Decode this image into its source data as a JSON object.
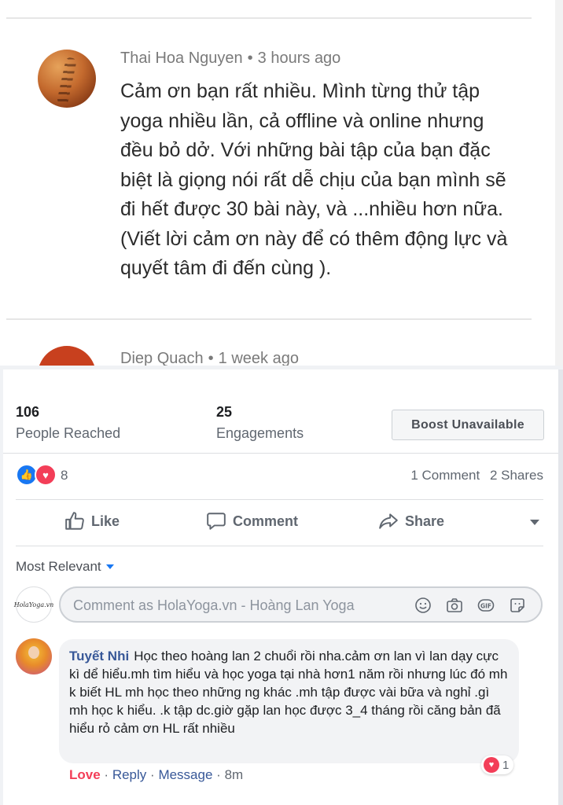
{
  "comments_top": [
    {
      "author": "Thai Hoa Nguyen",
      "time": "3 hours ago",
      "body": "Cảm ơn bạn rất nhiều. Mình từng thử tập yoga nhiều lần, cả offline và online nhưng đều bỏ dở. Với những bài tập của bạn đặc biệt là giọng nói rất dễ chịu của bạn mình sẽ đi hết được 30 bài này, và ...nhiều hơn nữa. (Viết lời cảm ơn này để có thêm động lực và quyết tâm đi đến cùng )."
    },
    {
      "author": "Diep Quach",
      "time": "1 week ago"
    }
  ],
  "separator": "•",
  "stats": {
    "reached_value": "106",
    "reached_label": "People Reached",
    "engagements_value": "25",
    "engagements_label": "Engagements",
    "boost_label": "Boost Unavailable"
  },
  "reactions": {
    "count": "8",
    "comments": "1 Comment",
    "shares": "2 Shares"
  },
  "actions": {
    "like": "Like",
    "comment": "Comment",
    "share": "Share"
  },
  "sort": "Most Relevant",
  "composer": {
    "placeholder": "Comment as HolaYoga.vn - Hoàng Lan Yoga",
    "page_logo_text": "HolaYoga.vn"
  },
  "reply": {
    "author": "Tuyết Nhi",
    "text": "Học theo hoàng lan 2 chuổi rồi nha.cảm ơn lan vì lan dạy cực kì dể hiểu.mh tìm hiểu và học yoga tại nhà hơn1 năm rồi nhưng lúc đó mh k biết HL mh học theo những ng khác .mh tập được vài bữa và nghỉ .gì mh học k hiểu. .k tập dc.giờ gặp lan học được 3_4 tháng rồi căng bản đã hiểu rỏ cảm ơn HL rất nhiều",
    "love_count": "1",
    "love_label": "Love",
    "reply_label": "Reply",
    "message_label": "Message",
    "time": "8m",
    "dot": "·"
  },
  "colors": {
    "link": "#385898",
    "love": "#f33e58",
    "like": "#1877f2"
  }
}
